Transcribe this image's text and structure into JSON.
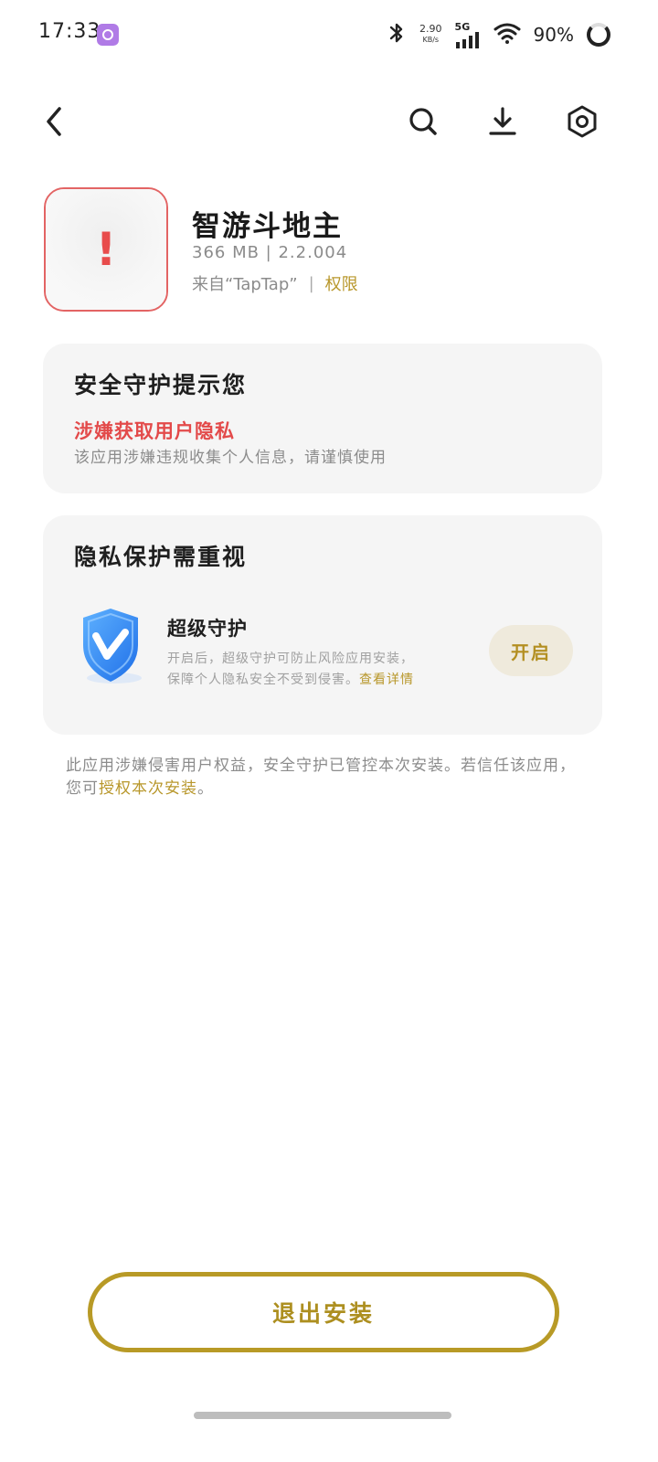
{
  "status_bar": {
    "time": "17:33",
    "net_speed_value": "2.90",
    "net_speed_unit": "KB/s",
    "network": "5G",
    "battery": "90%"
  },
  "nav": {
    "back_icon": "back-arrow-icon",
    "search_icon": "search-icon",
    "download_icon": "download-icon",
    "settings_icon": "settings-hexagon-icon"
  },
  "app": {
    "name": "智游斗地主",
    "meta": "366 MB | 2.2.004",
    "source": "来自“TapTap”",
    "source_sep": "|",
    "permissions_label": "权限"
  },
  "warning_card": {
    "title": "安全守护提示您",
    "risk_title": "涉嫌获取用户隐私",
    "risk_desc": "该应用涉嫌违规收集个人信息，请谨慎使用"
  },
  "privacy_card": {
    "title": "隐私保护需重视",
    "guard_title": "超级守护",
    "guard_desc_line1": "开启后，超级守护可防止风险应用安装，",
    "guard_desc_line2": "保障个人隐私安全不受到侵害。",
    "detail_link": "查看详情",
    "enable_label": "开启"
  },
  "notice": {
    "text": "此应用涉嫌侵害用户权益，安全守护已管控本次安装。若信任该应用，您可",
    "auth_link": "授权本次安装",
    "end": "。"
  },
  "exit_button": {
    "label": "退出安装"
  },
  "colors": {
    "accent_gold": "#b8972b",
    "warning_red": "#e34a4a",
    "card_bg": "#f5f5f5"
  }
}
